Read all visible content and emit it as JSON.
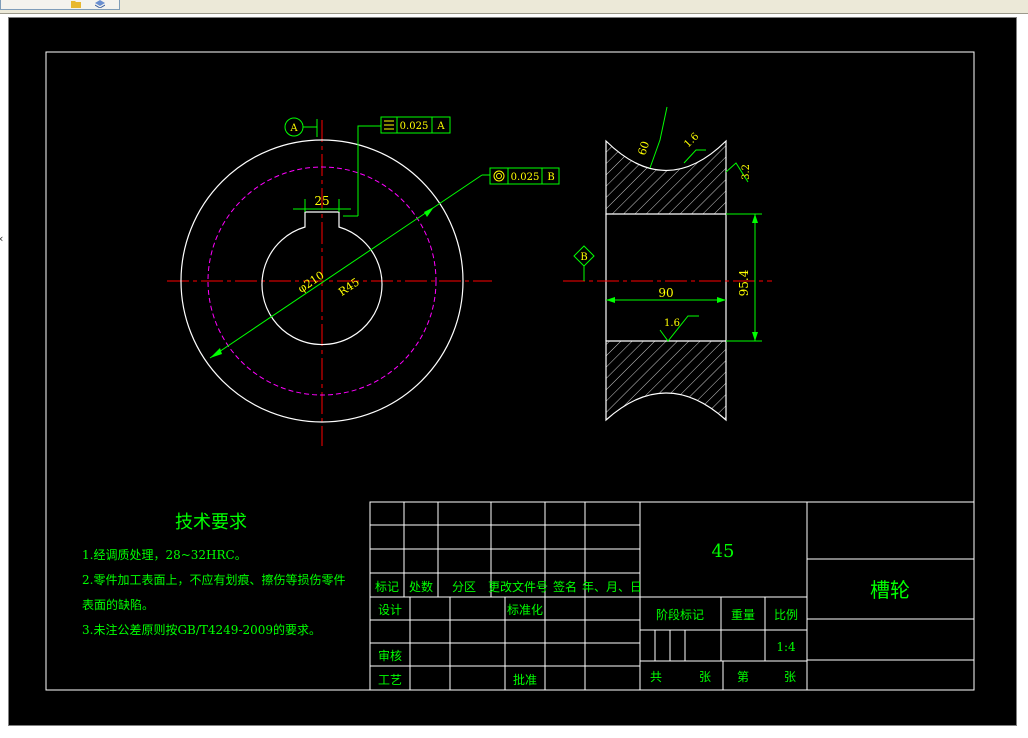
{
  "colors": {
    "background": "#000000",
    "lines": "#ffffff",
    "centerline": "#ff0000",
    "dimension": "#00ff00",
    "pitch_circle": "#ff00ff",
    "annotation_text": "#ffff00",
    "title_text": "#00ff00"
  },
  "icons": [
    "folder-icon",
    "layers-icon"
  ],
  "drawing": {
    "datum_a": "A",
    "datum_b": "B",
    "symmetry_tolerance": "0.025",
    "symmetry_ref": "A",
    "runout_tolerance": "0.025",
    "runout_ref": "B",
    "keyway_width": "25",
    "bore_diameter": "φ210",
    "bore_radius": "R45",
    "groove_roughness": "3.2",
    "groove_angle": "60",
    "groove_note": "1.6",
    "side_roughness": "3.2",
    "hub_width": "90",
    "bore_depth": "95.4",
    "bore_roughness": "1.6"
  },
  "tech_requirements": {
    "title": "技术要求",
    "items": [
      "1.经调质处理，28~32HRC。",
      "2.零件加工表面上，不应有划痕、擦伤等损伤零件",
      "表面的缺陷。",
      "3.未注公差原则按GB/T4249-2009的要求。"
    ]
  },
  "title_block": {
    "material": "45",
    "part_name": "槽轮",
    "headers": [
      "标记",
      "处数",
      "分区",
      "更改文件号",
      "签名",
      "年、月、日"
    ],
    "design": "设计",
    "standardization": "标准化",
    "review": "审核",
    "process": "工艺",
    "approve": "批准",
    "stage_mark": "阶段标记",
    "weight": "重量",
    "scale_label": "比例",
    "scale_value": "1:4",
    "total": "共",
    "sheets": "张",
    "sheet_no": "第",
    "sheets2": "张"
  }
}
